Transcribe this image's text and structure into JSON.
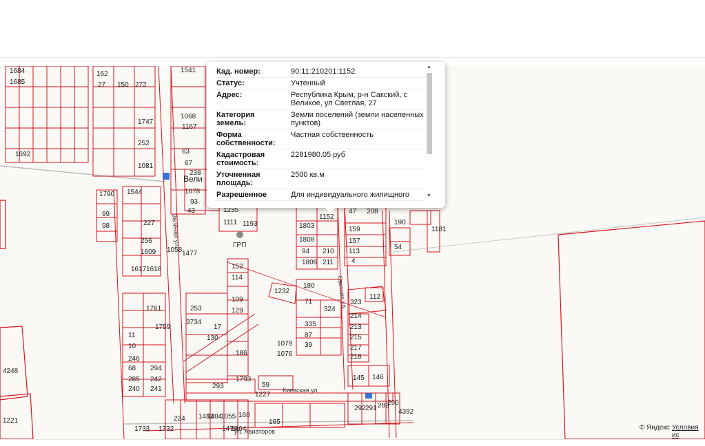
{
  "popup": {
    "rows": [
      {
        "key": "Кад. номер:",
        "value": "90:11:210201:1152"
      },
      {
        "key": "Статус:",
        "value": "Учтенный"
      },
      {
        "key": "Адрес:",
        "value": "Республика Крым, р-н Сакский, с Великое, ул Светлая, 27"
      },
      {
        "key": "Категория земель:",
        "value": "Земли поселений (земли населенных пунктов)"
      },
      {
        "key": "Форма собственности:",
        "value": "Частная собственность"
      },
      {
        "key": "Кадастровая стоимость:",
        "value": "2281980.05 руб"
      },
      {
        "key": "Уточненная площадь:",
        "value": "2500 кв.м"
      },
      {
        "key": "Разрешенное",
        "value": "Для индивидуального жилищного"
      }
    ]
  },
  "map": {
    "parcel_color": "#d4141c",
    "streets": {
      "zelenaya": "Зеленая ул.",
      "svetlaya": "Светлая ул.",
      "kievskaya": "Киевская ул.",
      "aviatorov": "ул. Авиаторов",
      "velikoe": "Вели"
    },
    "poi": "ГРП",
    "parcel_labels": [
      "1684",
      "1685",
      "162",
      "27",
      "150",
      "272",
      "1541",
      "1068",
      "1167",
      "1747",
      "252",
      "1081",
      "1692",
      "63",
      "67",
      "238",
      "1078",
      "93",
      "43",
      "1544",
      "1790",
      "99",
      "98",
      "227",
      "256",
      "1609",
      "1617",
      "1618",
      "1235",
      "1111",
      "1193",
      "1058",
      "1477",
      "152",
      "114",
      "109",
      "129",
      "1761",
      "253",
      "3734",
      "1759",
      "17",
      "130",
      "11",
      "10",
      "246",
      "68",
      "294",
      "285",
      "242",
      "240",
      "241",
      "186",
      "1793",
      "293",
      "59",
      "1227",
      "224",
      "1483",
      "1484",
      "1055",
      "160",
      "1476",
      "1464",
      "165",
      "1733",
      "1732",
      "1803",
      "1808",
      "94",
      "210",
      "1806",
      "211",
      "1152",
      "47",
      "208",
      "159",
      "157",
      "113",
      "4",
      "180",
      "1232",
      "71",
      "324",
      "323",
      "112",
      "214",
      "335",
      "87",
      "39",
      "213",
      "215",
      "217",
      "216",
      "1079",
      "1076",
      "145",
      "146",
      "292",
      "291",
      "289",
      "290",
      "4392",
      "190",
      "54",
      "1181",
      "4248",
      "1221"
    ]
  },
  "copyright": {
    "brand": "© Яндекс",
    "terms": "Условия ис"
  }
}
